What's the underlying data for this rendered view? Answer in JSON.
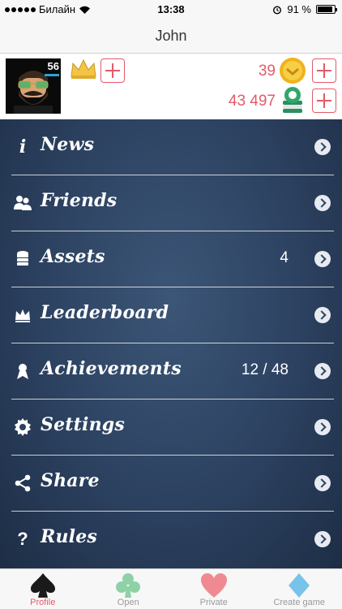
{
  "status_bar": {
    "carrier": "Билайн",
    "time": "13:38",
    "battery": "91 %",
    "battery_level": 0.91
  },
  "nav": {
    "title": "John"
  },
  "profile": {
    "level": "56",
    "coins": "39",
    "chips": "43 497"
  },
  "menu": {
    "items": [
      {
        "label": "News",
        "value": "",
        "icon": "info-icon"
      },
      {
        "label": "Friends",
        "value": "",
        "icon": "friends-icon"
      },
      {
        "label": "Assets",
        "value": "4",
        "icon": "coins-stack-icon"
      },
      {
        "label": "Leaderboard",
        "value": "",
        "icon": "crown-icon"
      },
      {
        "label": "Achievements",
        "value": "12 / 48",
        "icon": "ribbon-icon"
      },
      {
        "label": "Settings",
        "value": "",
        "icon": "gear-icon"
      },
      {
        "label": "Share",
        "value": "",
        "icon": "share-icon"
      },
      {
        "label": "Rules",
        "value": "",
        "icon": "question-icon"
      }
    ]
  },
  "tabs": [
    {
      "label": "Profile",
      "icon": "spade-icon",
      "color": "#1a1a1a"
    },
    {
      "label": "Open",
      "icon": "club-icon",
      "color": "#8fd1a6"
    },
    {
      "label": "Private",
      "icon": "heart-icon",
      "color": "#ef8a92"
    },
    {
      "label": "Create game",
      "icon": "diamond-icon",
      "color": "#77c3ea"
    }
  ],
  "colors": {
    "accent": "#e35a6b",
    "menu_bg": "#2c4160"
  }
}
